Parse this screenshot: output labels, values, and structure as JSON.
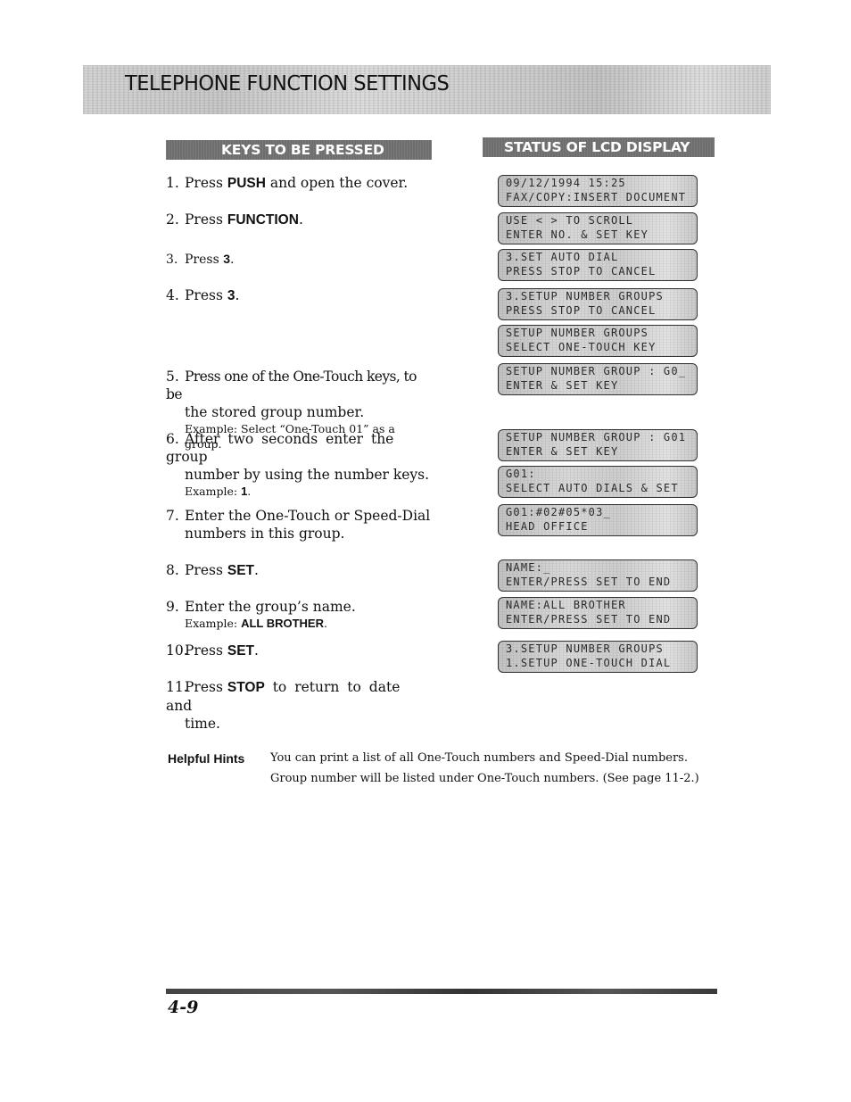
{
  "title": "TELEPHONE FUNCTION SETTINGS",
  "columns": {
    "keys_header": "KEYS TO BE PRESSED",
    "lcd_header": "STATUS OF LCD DISPLAY"
  },
  "steps": [
    {
      "num": "1.",
      "pre": "Press ",
      "key": "PUSH",
      "post": " and open the cover."
    },
    {
      "num": "2.",
      "pre": "Press ",
      "key": "FUNCTION",
      "post": "."
    },
    {
      "num": "3.",
      "pre": "Press ",
      "key": "3",
      "post": "."
    },
    {
      "num": "4.",
      "pre": "Press ",
      "key": "3",
      "post": "."
    },
    {
      "num": "5.",
      "line1": "Press one of the One-Touch keys, to be",
      "line2": "the stored group number.",
      "example": "Example: Select “One-Touch 01” as a group."
    },
    {
      "num": "6.",
      "line1": "After two seconds enter the group",
      "line2": "number by using the number keys.",
      "example_pre": "Example: ",
      "example_key": "1",
      "example_post": "."
    },
    {
      "num": "7.",
      "line1": "Enter the One-Touch or Speed-Dial",
      "line2": "numbers in this group."
    },
    {
      "num": "8.",
      "pre": "Press ",
      "key": "SET",
      "post": "."
    },
    {
      "num": "9.",
      "line1": "Enter the group’s name.",
      "example_pre": "Example: ",
      "example_key": "ALL BROTHER",
      "example_post": "."
    },
    {
      "num": "10.",
      "pre": "Press ",
      "key": "SET",
      "post": "."
    },
    {
      "num": "11.",
      "pre": "Press ",
      "key": "STOP",
      "post": " to return to date and",
      "line2": "time."
    }
  ],
  "lcd_displays": [
    {
      "line1": "09/12/1994 15:25",
      "line2": "FAX/COPY:INSERT DOCUMENT"
    },
    {
      "line1": "USE < > TO SCROLL",
      "line2": "ENTER NO. & SET KEY"
    },
    {
      "line1": "3.SET AUTO DIAL",
      "line2": "PRESS STOP TO CANCEL"
    },
    {
      "line1": "3.SETUP NUMBER GROUPS",
      "line2": "PRESS STOP TO CANCEL"
    },
    {
      "line1": "SETUP NUMBER GROUPS",
      "line2": "SELECT ONE-TOUCH KEY"
    },
    {
      "line1": "SETUP NUMBER GROUP : G0_",
      "line2": "ENTER & SET KEY"
    },
    {
      "line1": "SETUP NUMBER GROUP : G01",
      "line2": "ENTER & SET KEY"
    },
    {
      "line1": "G01:",
      "line2": "SELECT AUTO DIALS & SET"
    },
    {
      "line1": "G01:#02#05*03_",
      "line2": "HEAD OFFICE"
    },
    {
      "line1": "NAME:_",
      "line2": "ENTER/PRESS SET TO END"
    },
    {
      "line1": "NAME:ALL BROTHER",
      "line2": "ENTER/PRESS SET TO END"
    },
    {
      "line1": "3.SETUP NUMBER GROUPS",
      "line2": "1.SETUP ONE-TOUCH DIAL"
    }
  ],
  "hints": {
    "label": "Helpful Hints",
    "text": "You can print a list of all One-Touch numbers and Speed-Dial numbers. Group number will be listed under One-Touch numbers. (See page 11-2.)"
  },
  "page_number": "4-9"
}
